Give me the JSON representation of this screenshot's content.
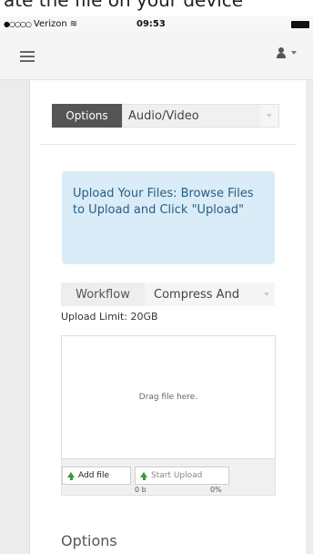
{
  "top_caption": "ate the file on your device",
  "status_bar": {
    "carrier": "Verizon",
    "time": "09:53"
  },
  "nav": {
    "menu_icon": "hamburger-icon",
    "user_icon": "user-icon"
  },
  "options_select": {
    "label": "Options",
    "selected": "Audio/Video"
  },
  "callout": {
    "text": "Upload Your Files: Browse Files to Upload and Click \"Upload\""
  },
  "workflow": {
    "label": "Workflow",
    "selected": "Compress And"
  },
  "upload_limit": "Upload Limit: 20GB",
  "dropzone": {
    "text": "Drag file here."
  },
  "uploader": {
    "add_file_label": "Add file",
    "start_upload_label": "Start Upload",
    "size": "0 b",
    "percent": "0%"
  },
  "options_heading": "Options",
  "colors": {
    "callout_bg": "#d9ecf7",
    "callout_text": "#2d5d80",
    "label_dark": "#555555",
    "icon_green": "#3c9a3c"
  }
}
